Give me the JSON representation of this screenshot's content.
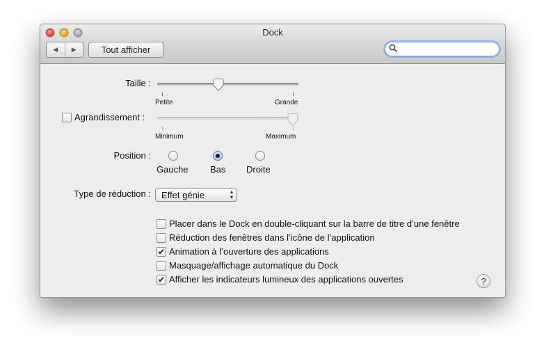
{
  "window": {
    "title": "Dock",
    "show_all_label": "Tout afficher",
    "back_glyph": "◀",
    "forward_glyph": "▶",
    "search_placeholder": "",
    "search_icon": "search-icon"
  },
  "size": {
    "label": "Taille :",
    "min_label": "Petite",
    "max_label": "Grande",
    "value_fraction": 0.43
  },
  "magnification": {
    "label": "Agrandissement :",
    "checked": false,
    "min_label": "Minimum",
    "max_label": "Maximum",
    "value_fraction": 1.0
  },
  "position": {
    "label": "Position :",
    "options": [
      "Gauche",
      "Bas",
      "Droite"
    ],
    "selected": "Bas"
  },
  "minimize": {
    "label": "Type de réduction :",
    "selected": "Effet génie"
  },
  "options": [
    {
      "label": "Placer dans le Dock en double-cliquant sur la barre de titre d’une fenêtre",
      "checked": false
    },
    {
      "label": "Réduction des fenêtres dans l’icône de l’application",
      "checked": false
    },
    {
      "label": "Animation à l’ouverture des applications",
      "checked": true
    },
    {
      "label": "Masquage/affichage automatique du Dock",
      "checked": false
    },
    {
      "label": "Afficher les indicateurs lumineux des applications ouvertes",
      "checked": true
    }
  ],
  "check_glyph": "✔",
  "help_label": "?",
  "colors": {
    "accent": "#5a7fb5",
    "search_focus": "#7ea7d8"
  }
}
